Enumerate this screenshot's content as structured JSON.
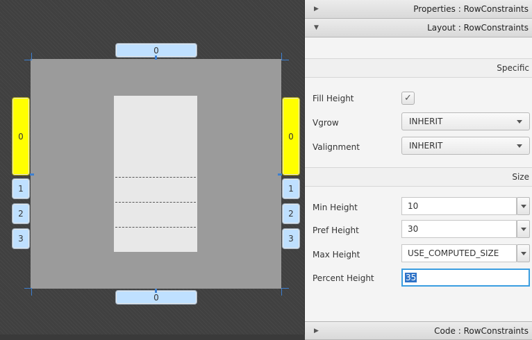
{
  "canvas": {
    "top_ruler": "0",
    "bottom_ruler": "0",
    "left_rows": [
      "0",
      "1",
      "2",
      "3"
    ],
    "right_rows": [
      "0",
      "1",
      "2",
      "3"
    ]
  },
  "inspector": {
    "properties_header": "Properties : RowConstraints",
    "layout_header": "Layout : RowConstraints",
    "code_header": "Code : RowConstraints",
    "specific_section": "Specific",
    "size_section": "Size",
    "fill_height": {
      "label": "Fill Height",
      "checked": true,
      "mark": "✓"
    },
    "vgrow": {
      "label": "Vgrow",
      "value": "INHERIT"
    },
    "valignment": {
      "label": "Valignment",
      "value": "INHERIT"
    },
    "min_height": {
      "label": "Min Height",
      "value": "10"
    },
    "pref_height": {
      "label": "Pref Height",
      "value": "30"
    },
    "max_height": {
      "label": "Max Height",
      "value": "USE_COMPUTED_SIZE"
    },
    "percent_height": {
      "label": "Percent Height",
      "value": "35"
    }
  },
  "colors": {
    "selected_row": "#ffff00",
    "ruler": "#bfe0ff",
    "focus": "#3a9de0"
  },
  "icons": [
    "collapsed-arrow-icon",
    "expanded-arrow-icon",
    "checkmark-icon",
    "chevron-down-icon"
  ]
}
